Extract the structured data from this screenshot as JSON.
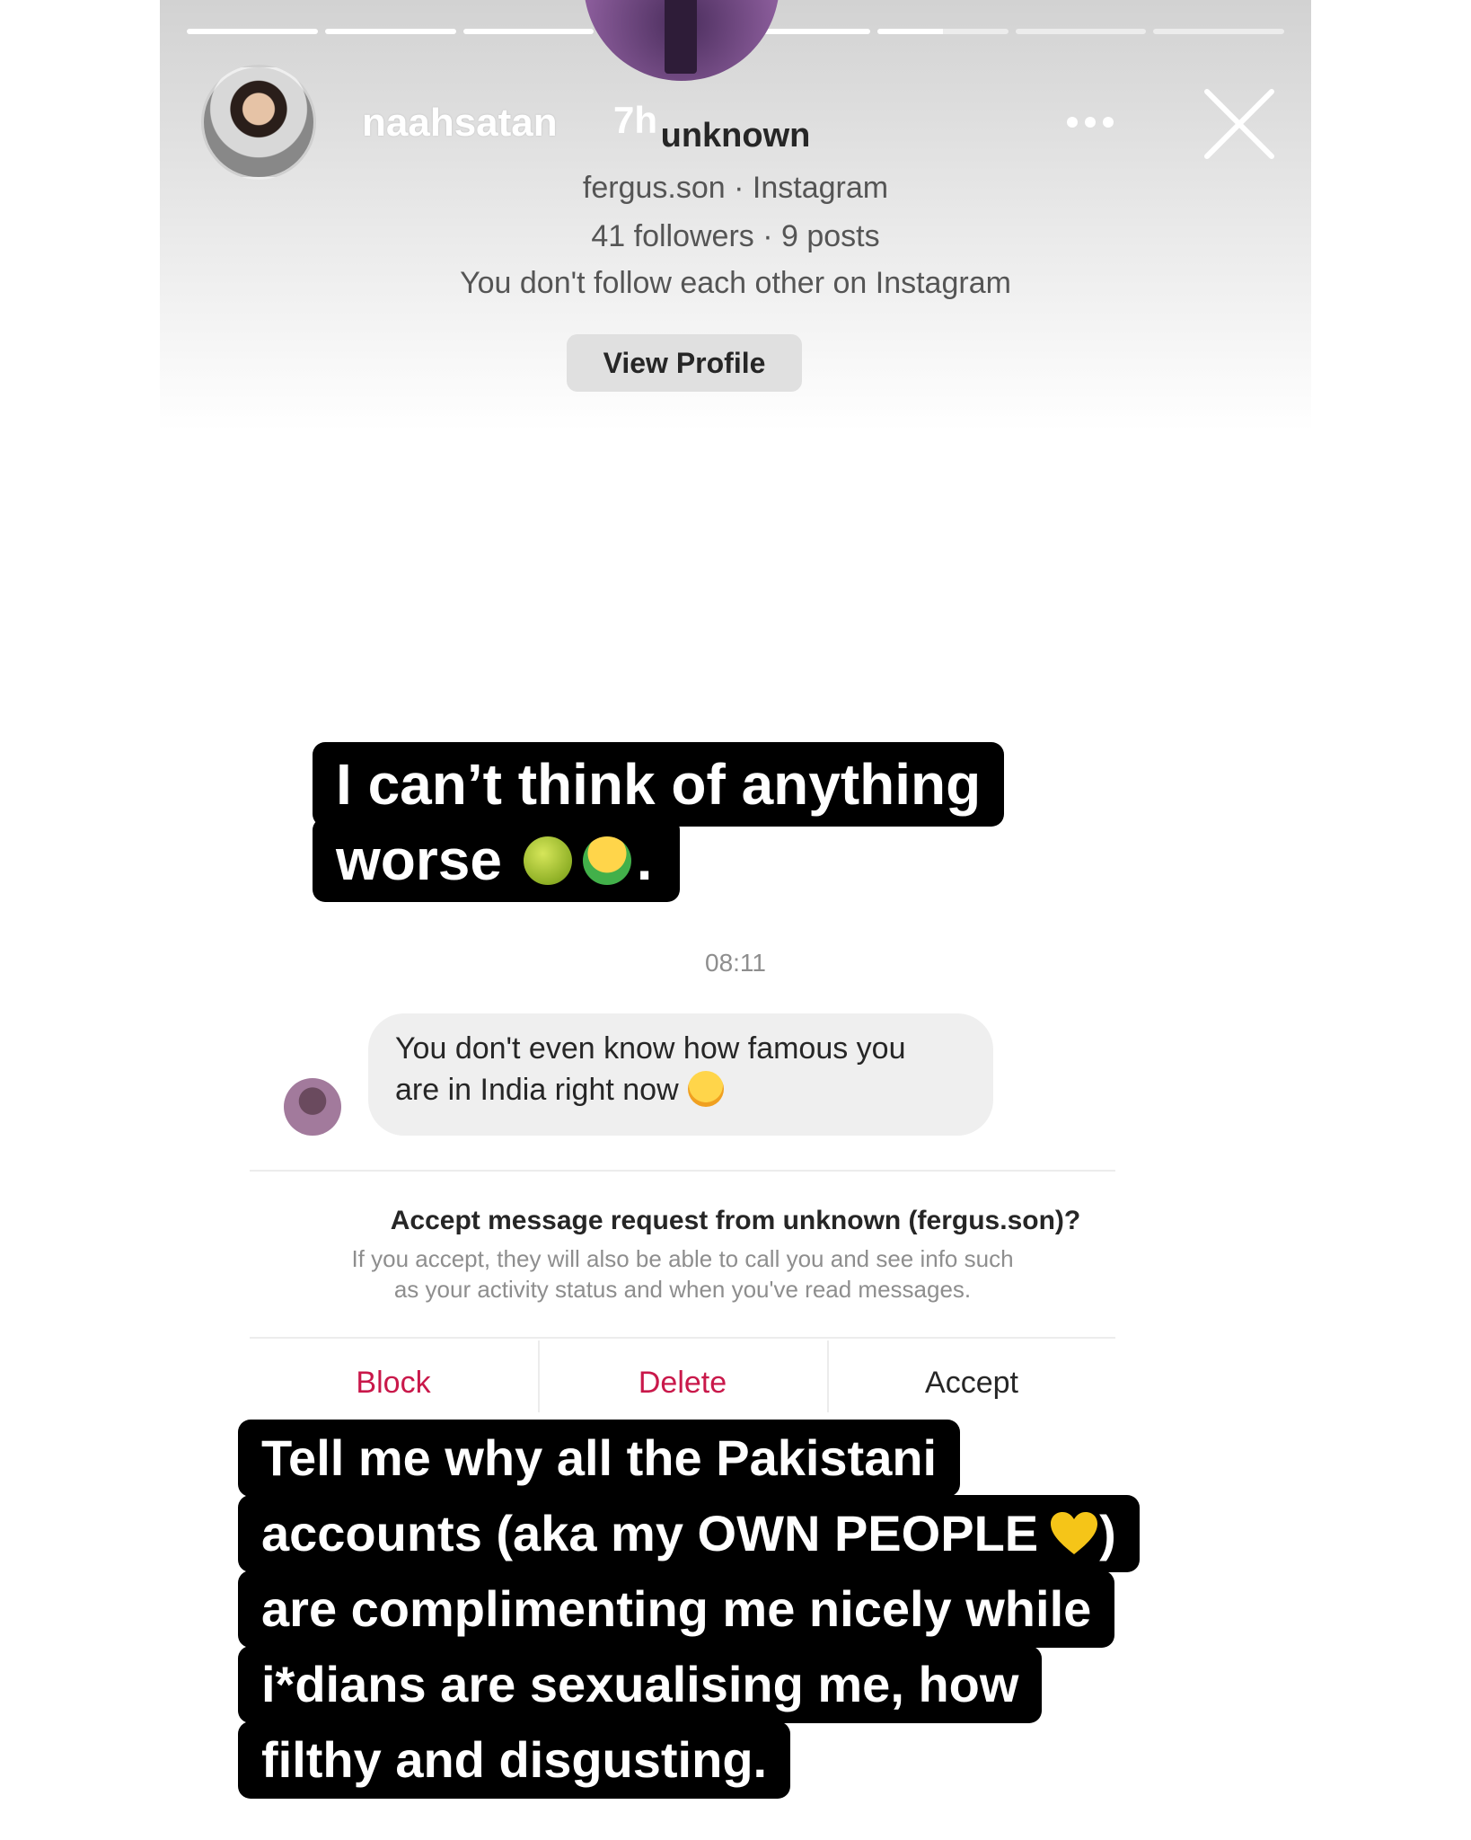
{
  "story": {
    "username": "naahsatan",
    "time": "7h",
    "progress": [
      1,
      1,
      1,
      1,
      1,
      0.5,
      0,
      0
    ]
  },
  "profile": {
    "name": "unknown",
    "handle_line": "fergus.son · Instagram",
    "stats_line": "41 followers · 9 posts",
    "follow_line": "You don't follow each other on Instagram",
    "view_profile_label": "View Profile"
  },
  "caption_top": {
    "line1": "I can’t think of anything",
    "line2": "worse",
    "emojis": [
      "nauseated-face",
      "vomiting-face"
    ],
    "trail": "."
  },
  "chat": {
    "timestamp": "08:11",
    "message_line1": "You don't even know how famous you",
    "message_line2": "are in India right now",
    "message_emoji": "face-with-tears-of-joy"
  },
  "request": {
    "title": "Accept message request from unknown (fergus.son)?",
    "body_line1": "If you accept, they will also be able to call you and see info such",
    "body_line2": "as your activity status and when you've read messages.",
    "block_label": "Block",
    "delete_label": "Delete",
    "accept_label": "Accept"
  },
  "caption_bottom": {
    "line1": "Tell me why all the Pakistani",
    "line2a": "accounts (aka my OWN PEOPLE",
    "line2b": ")",
    "line3": "are complimenting me nicely while",
    "line4": "i*dians are sexualising me, how",
    "line5": "filthy and disgusting.",
    "emoji": "yellow-heart"
  },
  "colors": {
    "destructive": "#c9184a",
    "caption_bg": "#000000",
    "caption_text": "#ffffff",
    "bubble_bg": "#efefef",
    "heart": "#f5c518"
  }
}
